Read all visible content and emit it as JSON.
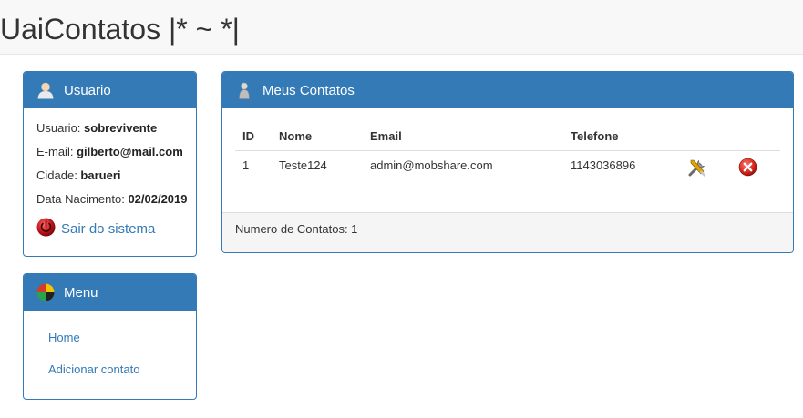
{
  "app": {
    "title": "UaiContatos |* ~ *|"
  },
  "user_panel": {
    "title": "Usuario",
    "icon": "user-icon",
    "fields": [
      {
        "label": "Usuario: ",
        "value": "sobrevivente"
      },
      {
        "label": "E-mail: ",
        "value": "gilberto@mail.com"
      },
      {
        "label": "Cidade: ",
        "value": "barueri"
      },
      {
        "label": "Data Nacimento: ",
        "value": "02/02/2019"
      }
    ],
    "logout_label": "Sair do sistema",
    "logout_icon": "power-off-icon"
  },
  "menu_panel": {
    "title": "Menu",
    "icon": "menu-icon",
    "items": [
      {
        "label": "Home"
      },
      {
        "label": "Adicionar contato"
      }
    ]
  },
  "contacts_panel": {
    "title": "Meus Contatos",
    "icon": "contacts-icon",
    "columns": [
      "ID",
      "Nome",
      "Email",
      "Telefone"
    ],
    "rows": [
      {
        "id": "1",
        "nome": "Teste124",
        "email": "admin@mobshare.com",
        "telefone": "1143036896"
      }
    ],
    "edit_icon": "tools-icon",
    "delete_icon": "delete-icon",
    "footer": "Numero de Contatos: 1"
  },
  "colors": {
    "primary": "#337ab7",
    "topbar": "#f8f8f8",
    "footer": "#f5f5f5",
    "danger": "#d9261c"
  }
}
